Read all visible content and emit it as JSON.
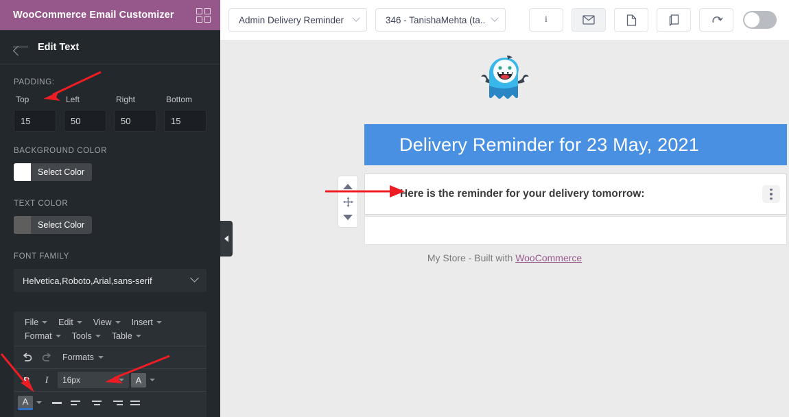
{
  "sidebar": {
    "brand_title": "WooCommerce Email Customizer",
    "grid_icon": "grid-icon",
    "back_icon": "back-arrow-icon",
    "panel_title": "Edit Text",
    "padding": {
      "label": "PADDING:",
      "fields": [
        {
          "caption": "Top",
          "value": "15"
        },
        {
          "caption": "Left",
          "value": "50"
        },
        {
          "caption": "Right",
          "value": "50"
        },
        {
          "caption": "Bottom",
          "value": "15"
        }
      ]
    },
    "background_color": {
      "label": "BACKGROUND COLOR",
      "button_label": "Select Color",
      "swatch": "#ffffff"
    },
    "text_color": {
      "label": "TEXT COLOR",
      "button_label": "Select Color",
      "swatch": "#5e5e5e"
    },
    "font_family": {
      "label": "FONT FAMILY",
      "value": "Helvetica,Roboto,Arial,sans-serif",
      "chevron_icon": "chevron-down-icon"
    }
  },
  "editor": {
    "menubar": [
      "File",
      "Edit",
      "View",
      "Insert",
      "Format",
      "Tools",
      "Table"
    ],
    "undo_icon": "undo-icon",
    "redo_icon": "redo-icon",
    "formats_label": "Formats",
    "bold_label": "B",
    "italic_label": "I",
    "fontsize_value": "16px",
    "textcolor_label": "A",
    "backcolor_label": "A"
  },
  "topbar": {
    "template_select": "Admin Delivery Reminder",
    "recipient_select": "346 - TanishaMehta (ta...",
    "buttons": [
      {
        "icon": "info-icon",
        "label": "i",
        "active": false
      },
      {
        "icon": "envelope-icon",
        "label": "",
        "active": true
      },
      {
        "icon": "page-icon",
        "label": "",
        "active": false
      },
      {
        "icon": "copy-icon",
        "label": "",
        "active": false
      },
      {
        "icon": "reset-icon",
        "label": "",
        "active": false
      }
    ],
    "toggle": {
      "name": "preview-toggle",
      "state": "off"
    }
  },
  "email": {
    "logo_icon": "monster-mascot-logo",
    "header_title": "Delivery Reminder for 23 May, 2021",
    "body_text": "Here is the reminder for your delivery tomorrow:",
    "kebab_icon": "more-options-icon",
    "drag_widget": {
      "up_icon": "move-up-icon",
      "move_icon": "drag-move-icon",
      "down_icon": "move-down-icon"
    },
    "footer_prefix": "My Store - Built with ",
    "footer_link": "WooCommerce"
  },
  "collapse": {
    "icon": "collapse-panel-icon"
  },
  "colors": {
    "brand_purple": "#96588a",
    "sidebar_dark": "#23282d",
    "email_header_blue": "#4a90e2",
    "canvas_gray": "#ebebeb",
    "annotation_red": "#ee1d24"
  }
}
